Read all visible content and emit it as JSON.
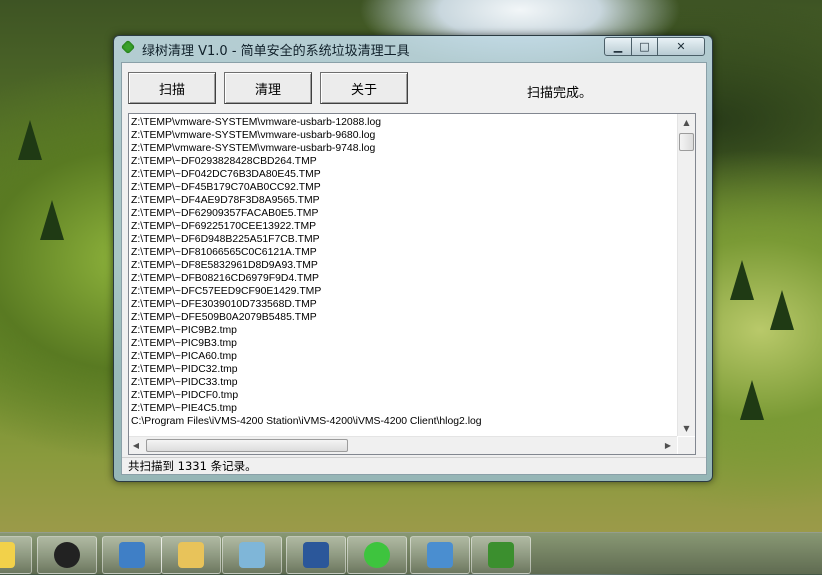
{
  "window": {
    "title": "绿树清理 V1.0 - 简单安全的系统垃圾清理工具",
    "caption_buttons": {
      "minimize": "▁",
      "maximize": "□",
      "close": "✕"
    }
  },
  "toolbar": {
    "scan_label": "扫描",
    "clean_label": "清理",
    "about_label": "关于",
    "status_text": "扫描完成。"
  },
  "file_list": [
    "Z:\\TEMP\\vmware-SYSTEM\\vmware-usbarb-12088.log",
    "Z:\\TEMP\\vmware-SYSTEM\\vmware-usbarb-9680.log",
    "Z:\\TEMP\\vmware-SYSTEM\\vmware-usbarb-9748.log",
    "Z:\\TEMP\\~DF0293828428CBD264.TMP",
    "Z:\\TEMP\\~DF042DC76B3DA80E45.TMP",
    "Z:\\TEMP\\~DF45B179C70AB0CC92.TMP",
    "Z:\\TEMP\\~DF4AE9D78F3D8A9565.TMP",
    "Z:\\TEMP\\~DF62909357FACAB0E5.TMP",
    "Z:\\TEMP\\~DF69225170CEE13922.TMP",
    "Z:\\TEMP\\~DF6D948B225A51F7CB.TMP",
    "Z:\\TEMP\\~DF81066565C0C6121A.TMP",
    "Z:\\TEMP\\~DF8E5832961D8D9A93.TMP",
    "Z:\\TEMP\\~DFB08216CD6979F9D4.TMP",
    "Z:\\TEMP\\~DFC57EED9CF90E1429.TMP",
    "Z:\\TEMP\\~DFE3039010D733568D.TMP",
    "Z:\\TEMP\\~DFE509B0A2079B5485.TMP",
    "Z:\\TEMP\\~PIC9B2.tmp",
    "Z:\\TEMP\\~PIC9B3.tmp",
    "Z:\\TEMP\\~PICA60.tmp",
    "Z:\\TEMP\\~PIDC32.tmp",
    "Z:\\TEMP\\~PIDC33.tmp",
    "Z:\\TEMP\\~PIDCF0.tmp",
    "Z:\\TEMP\\~PIE4C5.tmp",
    "C:\\Program Files\\iVMS-4200 Station\\iVMS-4200\\iVMS-4200 Client\\hlog2.log"
  ],
  "scrollbar": {
    "up": "▲",
    "down": "▼",
    "left": "◀",
    "right": "▶"
  },
  "status_bar": {
    "text": "共扫描到  1331  条记录。"
  },
  "taskbar": {
    "apps": [
      {
        "icon": "sticky-notes-icon",
        "color": "#f2d14a"
      },
      {
        "icon": "qq-penguin-icon",
        "color": "#222222"
      },
      {
        "icon": "control-panel-icon",
        "color": "#3f7fc6"
      },
      {
        "icon": "file-explorer-icon",
        "color": "#e8c35a"
      },
      {
        "icon": "notepad-icon",
        "color": "#7fb6d8"
      },
      {
        "icon": "word-icon",
        "color": "#2b579a"
      },
      {
        "icon": "wechat-icon",
        "color": "#3ec43e"
      },
      {
        "icon": "photo-viewer-icon",
        "color": "#4a8ed0"
      },
      {
        "icon": "green-tree-cleaner-icon",
        "color": "#3b8f2e"
      }
    ]
  }
}
